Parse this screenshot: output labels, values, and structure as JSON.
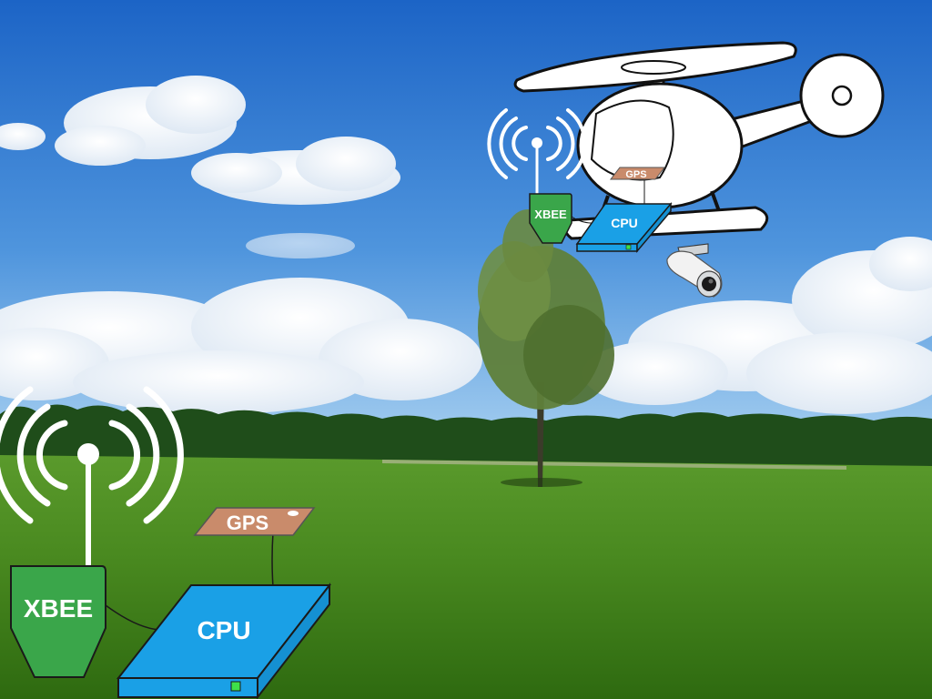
{
  "ground_station": {
    "xbee_label": "XBEE",
    "gps_label": "GPS",
    "cpu_label": "CPU"
  },
  "helicopter": {
    "xbee_label": "XBEE",
    "gps_label": "GPS",
    "cpu_label": "CPU"
  },
  "colors": {
    "sky_top": "#1e6fd0",
    "sky_bottom": "#8fc3ef",
    "grass_top": "#4e8f24",
    "grass_bottom": "#2f6d12",
    "treeline": "#1f4d1a",
    "xbee_green": "#3aa64a",
    "cpu_blue": "#1aa0e6",
    "gps_tan": "#c98b6b",
    "outline": "#111111",
    "white": "#ffffff"
  }
}
